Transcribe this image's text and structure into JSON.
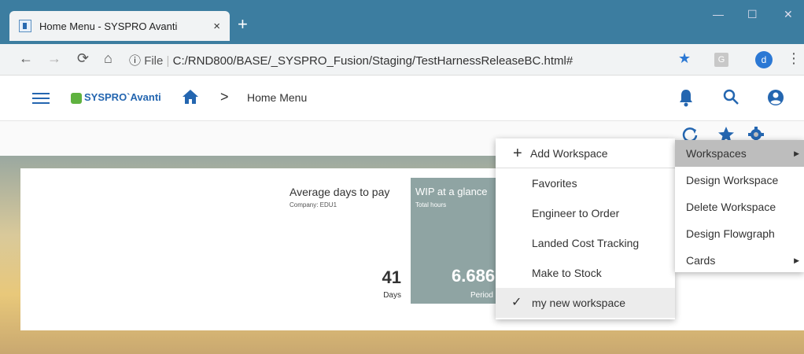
{
  "browser": {
    "tab_title": "Home Menu - SYSPRO Avanti",
    "tab_close": "×",
    "new_tab": "+",
    "window_controls": {
      "minimize": "—",
      "maximize": "☐",
      "close": "✕"
    },
    "address_info": "ⓘ",
    "address_prefix": "File",
    "address_url": "C:/RND800/BASE/_SYSPRO_Fusion/Staging/TestHarnessReleaseBC.html#",
    "extension": "G",
    "profile_initial": "d",
    "menu": "⋮"
  },
  "app": {
    "logo_text": "SYSPRO`Avanti",
    "breadcrumb_sep": ">",
    "breadcrumb": "Home Menu"
  },
  "cards": [
    {
      "title": "Average days to pay",
      "subtitle": "Company: EDU1",
      "value": "41",
      "unit": "Days"
    },
    {
      "title": "WIP at a glance",
      "subtitle": "Total hours",
      "value": "6.686",
      "unit": "Period"
    }
  ],
  "workspace_menu": {
    "add": "Add Workspace",
    "items": [
      {
        "label": "Favorites",
        "selected": false
      },
      {
        "label": "Engineer to Order",
        "selected": false
      },
      {
        "label": "Landed Cost Tracking",
        "selected": false
      },
      {
        "label": "Make to Stock",
        "selected": false
      },
      {
        "label": "my new workspace",
        "selected": true
      }
    ]
  },
  "main_menu": {
    "items": [
      {
        "label": "Workspaces",
        "submenu": true,
        "active": true
      },
      {
        "label": "Design Workspace",
        "submenu": false
      },
      {
        "label": "Delete Workspace",
        "submenu": false
      },
      {
        "label": "Design Flowgraph",
        "submenu": false
      },
      {
        "label": "Cards",
        "submenu": true
      }
    ],
    "submenu_arrow": "▶"
  },
  "colors": {
    "titlebar": "#3c7da0",
    "accent": "#2466b0",
    "card_wip": "#8fa4a3"
  }
}
